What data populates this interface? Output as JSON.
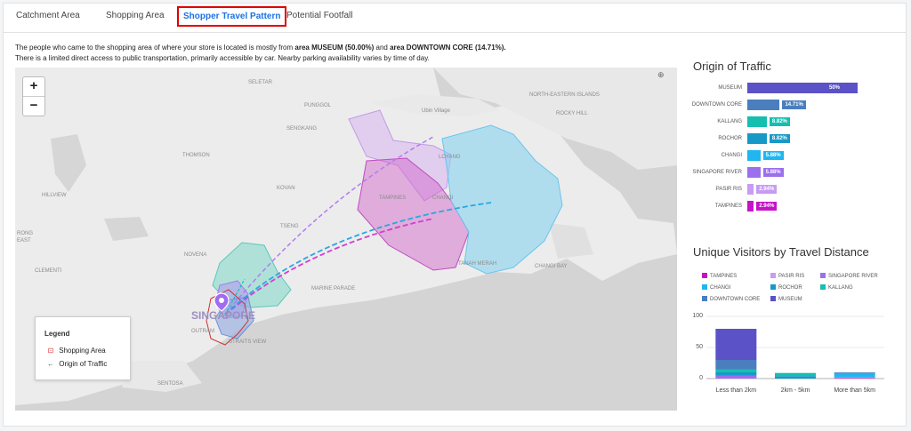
{
  "tabs": [
    {
      "label": "Catchment Area"
    },
    {
      "label": "Shopping Area"
    },
    {
      "label": "Shopper Travel Pattern",
      "active": true
    },
    {
      "label": "Potential Footfall"
    }
  ],
  "description": {
    "line1_pre": "The people who came to the shopping area of where your store is located is mostly from ",
    "line1_b1": "area MUSEUM (50.00%)",
    "line1_mid": " and ",
    "line1_b2": "area DOWNTOWN CORE (14.71%).",
    "line2": "There is a limited direct access to public transportation, primarily accessible by car. Nearby parking availability varies by time of day."
  },
  "map": {
    "zoom_in": "+",
    "zoom_out": "−",
    "labels": {
      "seletar": "SELETAR",
      "sengkang": "SENGKANG",
      "punggol": "PUNGGOL",
      "ubin": "Ubin Village",
      "ne_islands": "NORTH-EASTERN ISLANDS",
      "rocky": "ROCKY HILL",
      "thomson": "THOMSON",
      "loyang": "LOYANG",
      "kovan": "KOVAN",
      "tampines": "TAMPINES",
      "changi": "CHANGI",
      "tsengkang": "TSENG",
      "hillview": "HILLVIEW",
      "novena": "NOVENA",
      "clementi": "CLEMENTI",
      "marine": "MARINE PARADE",
      "singapore": "SINGAPORE",
      "outram": "OUTRAM",
      "straits": "STRAITS VIEW",
      "sentosa": "SENTOSA",
      "tanah": "TANAH MERAH",
      "changibay": "CHANGI BAY",
      "rong": "RONG",
      "east": "EAST"
    },
    "legend": {
      "title": "Legend",
      "shopping_area": "Shopping Area",
      "origin": "Origin of Traffic",
      "shopping_symbol": "⊡",
      "origin_symbol": "←"
    },
    "attribution": "⊕"
  },
  "origin_panel": {
    "title": "Origin of Traffic",
    "items": [
      {
        "label": "MUSEUM",
        "value": 50,
        "text": "50%",
        "color": "#5b52c8"
      },
      {
        "label": "DOWNTOWN CORE",
        "value": 14.71,
        "text": "14.71%",
        "color": "#4a7ebf"
      },
      {
        "label": "KALLANG",
        "value": 8.82,
        "text": "8.82%",
        "color": "#14bfb0"
      },
      {
        "label": "ROCHOR",
        "value": 8.82,
        "text": "8.82%",
        "color": "#1799c8"
      },
      {
        "label": "CHANGI",
        "value": 5.88,
        "text": "5.88%",
        "color": "#20b6ef"
      },
      {
        "label": "SINGAPORE RIVER",
        "value": 5.88,
        "text": "5.88%",
        "color": "#9c6fef"
      },
      {
        "label": "PASIR RIS",
        "value": 2.94,
        "text": "2.94%",
        "color": "#c79cf2"
      },
      {
        "label": "TAMPINES",
        "value": 2.94,
        "text": "2.94%",
        "color": "#c414c8"
      }
    ]
  },
  "chart_data": {
    "type": "bar",
    "title": "Unique Visitors by Travel Distance",
    "categories": [
      "Less than 2km",
      "2km - 5km",
      "More than 5km"
    ],
    "ylim": [
      0,
      100
    ],
    "yticks": [
      0,
      50,
      100
    ],
    "stacked": true,
    "series": [
      {
        "name": "TAMPINES",
        "color": "#c414c8",
        "values": [
          0,
          0,
          1
        ]
      },
      {
        "name": "PASIR RIS",
        "color": "#c79cf2",
        "values": [
          0,
          0,
          1
        ]
      },
      {
        "name": "SINGAPORE RIVER",
        "color": "#9c6fef",
        "values": [
          5,
          0,
          0
        ]
      },
      {
        "name": "CHANGI",
        "color": "#20b6ef",
        "values": [
          0,
          0,
          6
        ]
      },
      {
        "name": "ROCHOR",
        "color": "#1799c8",
        "values": [
          5,
          4,
          1
        ]
      },
      {
        "name": "KALLANG",
        "color": "#14bfb0",
        "values": [
          5,
          5,
          0
        ]
      },
      {
        "name": "DOWNTOWN CORE",
        "color": "#4a7ebf",
        "values": [
          15,
          0,
          1
        ]
      },
      {
        "name": "MUSEUM",
        "color": "#5b52c8",
        "values": [
          50,
          0,
          0
        ]
      }
    ]
  }
}
